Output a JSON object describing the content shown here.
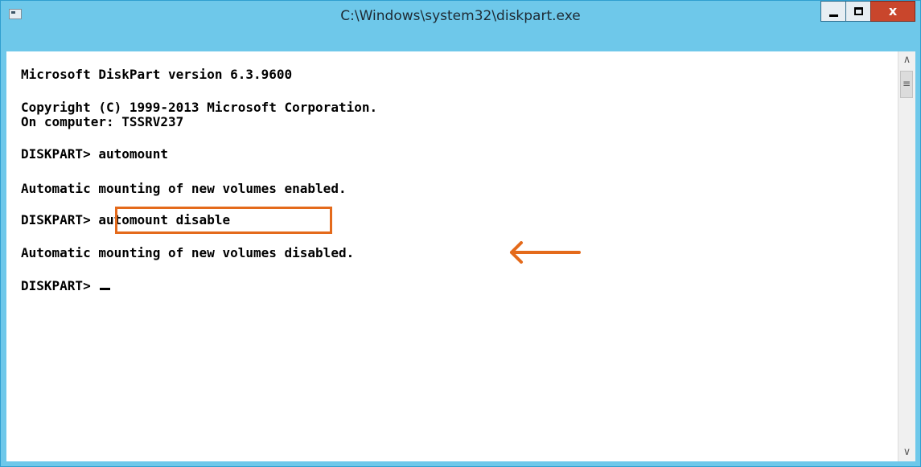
{
  "window": {
    "title": "C:\\Windows\\system32\\diskpart.exe",
    "close_glyph": "x"
  },
  "console": {
    "lines": [
      "Microsoft DiskPart version 6.3.9600",
      "Copyright (C) 1999-2013 Microsoft Corporation.",
      "On computer: TSSRV237",
      "DISKPART> automount",
      "Automatic mounting of new volumes enabled.",
      "DISKPART> automount disable",
      "Automatic mounting of new volumes disabled.",
      "DISKPART> "
    ]
  },
  "annotations": {
    "highlight_color": "#e46a1b",
    "arrow_color": "#e46a1b"
  },
  "colors": {
    "titlebar": "#6ec8ea",
    "close_button": "#c9462c",
    "console_background": "#ffffff",
    "console_text": "#000000"
  },
  "scrollbar": {
    "up_icon": "chevron-up-icon",
    "down_icon": "chevron-down-icon",
    "thumb_icon": "grip-icon"
  }
}
